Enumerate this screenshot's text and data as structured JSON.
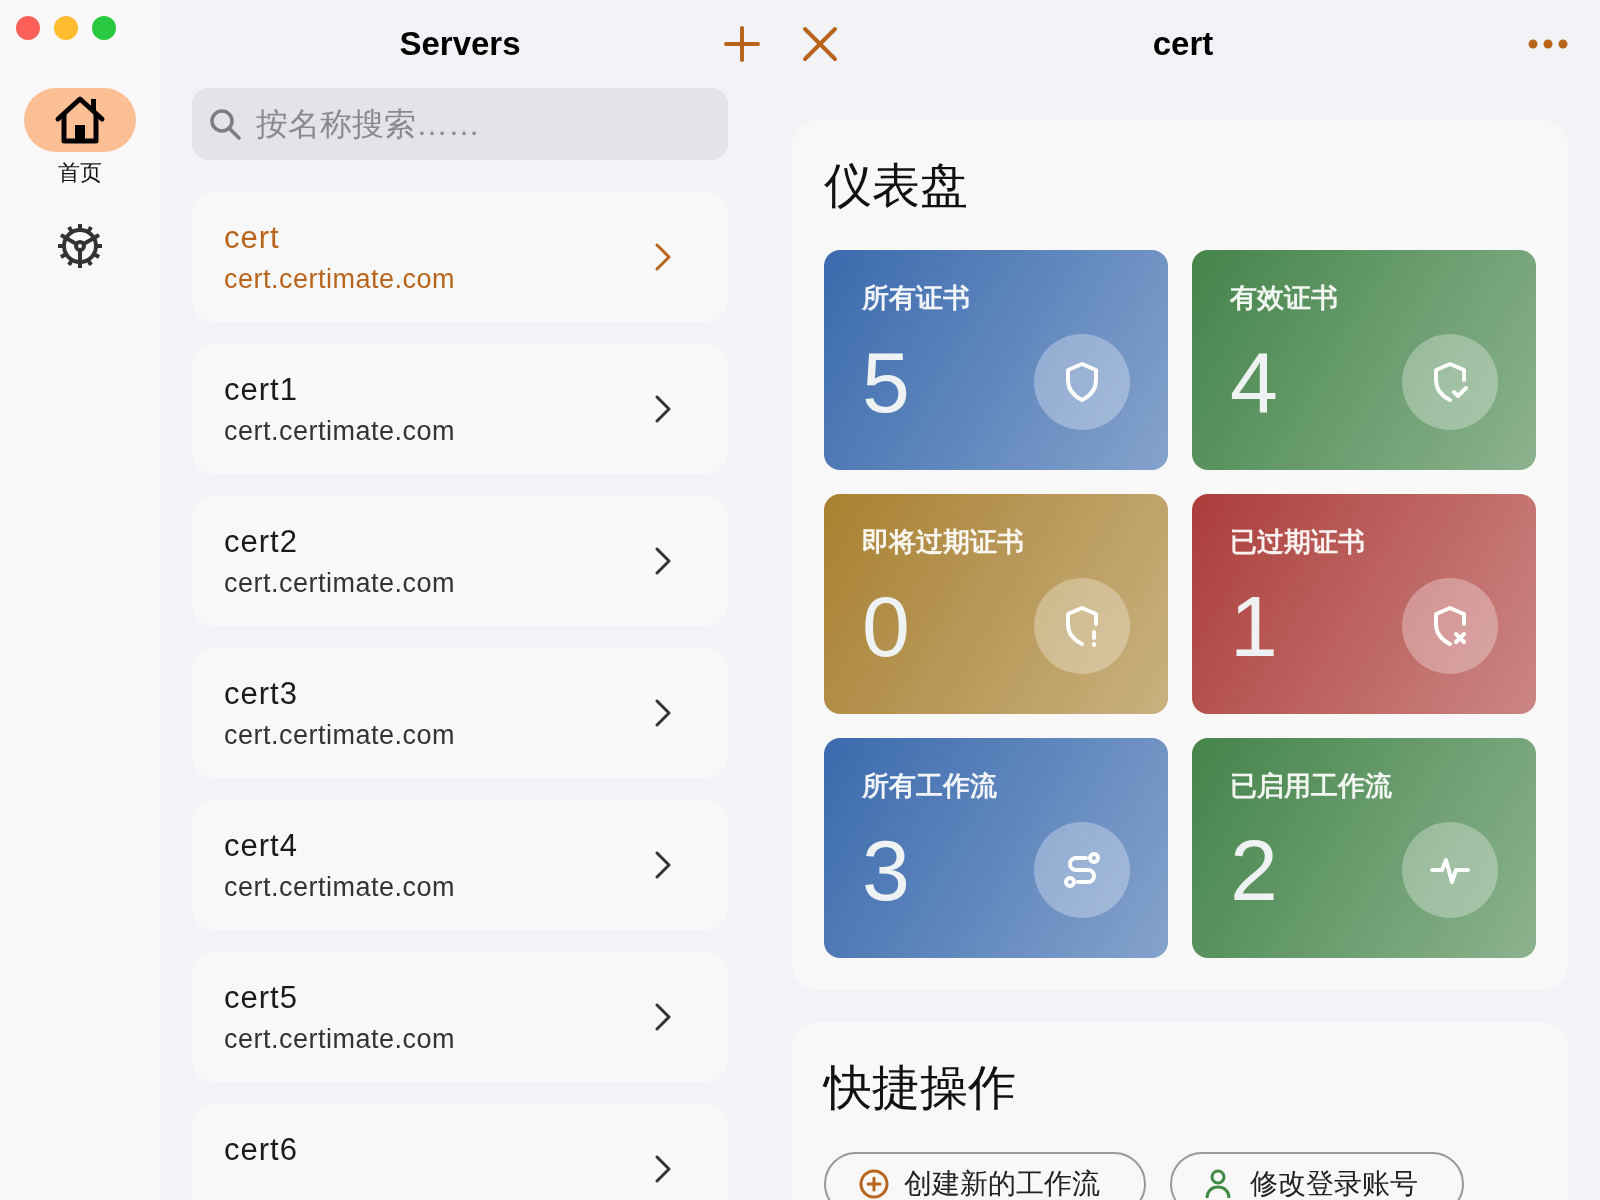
{
  "sidebar": {
    "items": [
      {
        "kind": "home",
        "label": "首页",
        "selected": true
      },
      {
        "kind": "settings",
        "selected": false
      }
    ]
  },
  "servers": {
    "title": "Servers",
    "search": {
      "placeholder": "按名称搜索……"
    },
    "items": [
      {
        "name": "cert",
        "host": "cert.certimate.com",
        "selected": true
      },
      {
        "name": "cert1",
        "host": "cert.certimate.com",
        "selected": false
      },
      {
        "name": "cert2",
        "host": "cert.certimate.com",
        "selected": false
      },
      {
        "name": "cert3",
        "host": "cert.certimate.com",
        "selected": false
      },
      {
        "name": "cert4",
        "host": "cert.certimate.com",
        "selected": false
      },
      {
        "name": "cert5",
        "host": "cert.certimate.com",
        "selected": false
      },
      {
        "name": "cert6",
        "selected": false
      }
    ]
  },
  "detail": {
    "title": "cert",
    "dashboard": {
      "title": "仪表盘",
      "cards": [
        {
          "label": "所有证书",
          "value": "5",
          "kind": "shield",
          "color": "#3a6aad"
        },
        {
          "label": "有效证书",
          "value": "4",
          "kind": "shield-check",
          "color": "#44844a"
        },
        {
          "label": "即将过期证书",
          "value": "0",
          "kind": "shield-alert",
          "color": "#a8812f"
        },
        {
          "label": "已过期证书",
          "value": "1",
          "kind": "shield-x",
          "color": "#ab3c3a"
        },
        {
          "label": "所有工作流",
          "value": "3",
          "kind": "route",
          "color": "#3a6aad"
        },
        {
          "label": "已启用工作流",
          "value": "2",
          "kind": "pulse",
          "color": "#44844a"
        }
      ]
    },
    "quick_actions": {
      "title": "快捷操作",
      "buttons": [
        {
          "label": "创建新的工作流",
          "kind": "add"
        },
        {
          "label": "修改登录账号",
          "kind": "user"
        }
      ]
    }
  }
}
